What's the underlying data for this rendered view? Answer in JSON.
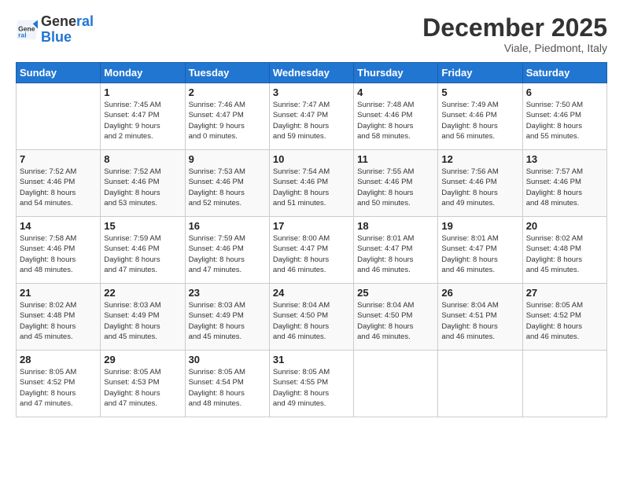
{
  "logo": {
    "line1": "General",
    "line2": "Blue"
  },
  "header": {
    "month": "December 2025",
    "location": "Viale, Piedmont, Italy"
  },
  "weekdays": [
    "Sunday",
    "Monday",
    "Tuesday",
    "Wednesday",
    "Thursday",
    "Friday",
    "Saturday"
  ],
  "weeks": [
    [
      {
        "day": "",
        "info": ""
      },
      {
        "day": "1",
        "info": "Sunrise: 7:45 AM\nSunset: 4:47 PM\nDaylight: 9 hours\nand 2 minutes."
      },
      {
        "day": "2",
        "info": "Sunrise: 7:46 AM\nSunset: 4:47 PM\nDaylight: 9 hours\nand 0 minutes."
      },
      {
        "day": "3",
        "info": "Sunrise: 7:47 AM\nSunset: 4:47 PM\nDaylight: 8 hours\nand 59 minutes."
      },
      {
        "day": "4",
        "info": "Sunrise: 7:48 AM\nSunset: 4:46 PM\nDaylight: 8 hours\nand 58 minutes."
      },
      {
        "day": "5",
        "info": "Sunrise: 7:49 AM\nSunset: 4:46 PM\nDaylight: 8 hours\nand 56 minutes."
      },
      {
        "day": "6",
        "info": "Sunrise: 7:50 AM\nSunset: 4:46 PM\nDaylight: 8 hours\nand 55 minutes."
      }
    ],
    [
      {
        "day": "7",
        "info": "Sunrise: 7:52 AM\nSunset: 4:46 PM\nDaylight: 8 hours\nand 54 minutes."
      },
      {
        "day": "8",
        "info": "Sunrise: 7:52 AM\nSunset: 4:46 PM\nDaylight: 8 hours\nand 53 minutes."
      },
      {
        "day": "9",
        "info": "Sunrise: 7:53 AM\nSunset: 4:46 PM\nDaylight: 8 hours\nand 52 minutes."
      },
      {
        "day": "10",
        "info": "Sunrise: 7:54 AM\nSunset: 4:46 PM\nDaylight: 8 hours\nand 51 minutes."
      },
      {
        "day": "11",
        "info": "Sunrise: 7:55 AM\nSunset: 4:46 PM\nDaylight: 8 hours\nand 50 minutes."
      },
      {
        "day": "12",
        "info": "Sunrise: 7:56 AM\nSunset: 4:46 PM\nDaylight: 8 hours\nand 49 minutes."
      },
      {
        "day": "13",
        "info": "Sunrise: 7:57 AM\nSunset: 4:46 PM\nDaylight: 8 hours\nand 48 minutes."
      }
    ],
    [
      {
        "day": "14",
        "info": "Sunrise: 7:58 AM\nSunset: 4:46 PM\nDaylight: 8 hours\nand 48 minutes."
      },
      {
        "day": "15",
        "info": "Sunrise: 7:59 AM\nSunset: 4:46 PM\nDaylight: 8 hours\nand 47 minutes."
      },
      {
        "day": "16",
        "info": "Sunrise: 7:59 AM\nSunset: 4:46 PM\nDaylight: 8 hours\nand 47 minutes."
      },
      {
        "day": "17",
        "info": "Sunrise: 8:00 AM\nSunset: 4:47 PM\nDaylight: 8 hours\nand 46 minutes."
      },
      {
        "day": "18",
        "info": "Sunrise: 8:01 AM\nSunset: 4:47 PM\nDaylight: 8 hours\nand 46 minutes."
      },
      {
        "day": "19",
        "info": "Sunrise: 8:01 AM\nSunset: 4:47 PM\nDaylight: 8 hours\nand 46 minutes."
      },
      {
        "day": "20",
        "info": "Sunrise: 8:02 AM\nSunset: 4:48 PM\nDaylight: 8 hours\nand 45 minutes."
      }
    ],
    [
      {
        "day": "21",
        "info": "Sunrise: 8:02 AM\nSunset: 4:48 PM\nDaylight: 8 hours\nand 45 minutes."
      },
      {
        "day": "22",
        "info": "Sunrise: 8:03 AM\nSunset: 4:49 PM\nDaylight: 8 hours\nand 45 minutes."
      },
      {
        "day": "23",
        "info": "Sunrise: 8:03 AM\nSunset: 4:49 PM\nDaylight: 8 hours\nand 45 minutes."
      },
      {
        "day": "24",
        "info": "Sunrise: 8:04 AM\nSunset: 4:50 PM\nDaylight: 8 hours\nand 46 minutes."
      },
      {
        "day": "25",
        "info": "Sunrise: 8:04 AM\nSunset: 4:50 PM\nDaylight: 8 hours\nand 46 minutes."
      },
      {
        "day": "26",
        "info": "Sunrise: 8:04 AM\nSunset: 4:51 PM\nDaylight: 8 hours\nand 46 minutes."
      },
      {
        "day": "27",
        "info": "Sunrise: 8:05 AM\nSunset: 4:52 PM\nDaylight: 8 hours\nand 46 minutes."
      }
    ],
    [
      {
        "day": "28",
        "info": "Sunrise: 8:05 AM\nSunset: 4:52 PM\nDaylight: 8 hours\nand 47 minutes."
      },
      {
        "day": "29",
        "info": "Sunrise: 8:05 AM\nSunset: 4:53 PM\nDaylight: 8 hours\nand 47 minutes."
      },
      {
        "day": "30",
        "info": "Sunrise: 8:05 AM\nSunset: 4:54 PM\nDaylight: 8 hours\nand 48 minutes."
      },
      {
        "day": "31",
        "info": "Sunrise: 8:05 AM\nSunset: 4:55 PM\nDaylight: 8 hours\nand 49 minutes."
      },
      {
        "day": "",
        "info": ""
      },
      {
        "day": "",
        "info": ""
      },
      {
        "day": "",
        "info": ""
      }
    ]
  ]
}
